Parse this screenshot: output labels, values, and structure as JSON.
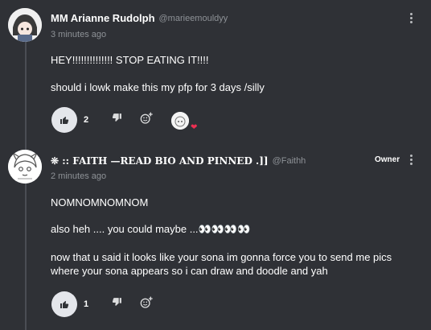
{
  "comments": [
    {
      "author": "MM Arianne Rudolph",
      "handle": "@marieemouldyy",
      "time": "3 minutes ago",
      "paragraphs": [
        "HEY!!!!!!!!!!!!!! STOP EATING IT!!!!",
        "should i lowk make this my pfp for 3 days /silly"
      ],
      "like_count": "2"
    },
    {
      "author": "❊ :: FAITH —READ BIO AND PINNED .]]",
      "handle": "@Faithh",
      "badge": "Owner",
      "time": "2 minutes ago",
      "paragraphs": [
        "NOMNOMNOMNOM",
        "also heh .... you could maybe ...👀👀👀👀",
        "now that u said it looks like your sona im gonna force you to send me pics",
        "where your sona appears so i can draw and doodle and yah"
      ],
      "like_count": "1"
    }
  ],
  "icons": {
    "like": "thumbs-up-icon",
    "dislike": "thumbs-down-icon",
    "react": "add-reaction-icon",
    "menu": "more-vertical-icon",
    "reacted": "heart-icon"
  },
  "colors": {
    "background": "#2f3136",
    "text": "#ffffff",
    "muted": "#8e9297",
    "heart": "#ed2f52"
  }
}
